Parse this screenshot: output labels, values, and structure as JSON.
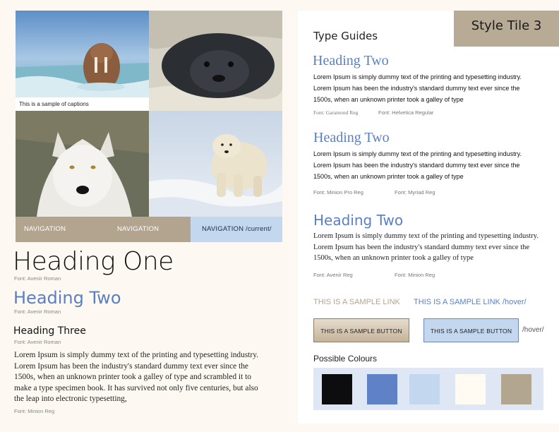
{
  "caption": "This is a sample of captions",
  "nav": {
    "item1": "NAVIGATION",
    "item2": "NAVIGATION",
    "item3": "NAVIGATION /current/"
  },
  "left": {
    "heading_one": "Heading One",
    "heading_one_font": "Font: Avenir Roman",
    "heading_two": "Heading Two",
    "heading_two_font": "Font: Avenir Roman",
    "heading_three": "Heading Three",
    "heading_three_font": "Font: Avenir Roman",
    "body": "Lorem Ipsum is simply dummy text of the printing and typesetting industry. Lorem Ipsum has been the industry's standard dummy text ever since the 1500s, when an unknown printer took a galley of type and scrambled it to make a type specimen book. It has survived not only five centuries, but also the leap into electronic typesetting,",
    "body_font": "Font: Minion Reg"
  },
  "right": {
    "style_tile": "Style Tile 3",
    "type_guides": "Type Guides",
    "guide1": {
      "heading": "Heading Two",
      "body": "Lorem Ipsum is simply dummy text of the printing and typesetting industry. Lorem Ipsum has been the industry's standard dummy text ever since the 1500s, when an unknown printer took a galley of type",
      "font_a": "Font: Garamond Reg",
      "font_b": "Font: Helvetica Regular"
    },
    "guide2": {
      "heading": "Heading Two",
      "body": "Lorem Ipsum is simply dummy text of the printing and typesetting industry. Lorem Ipsum has been the industry's standard dummy text ever since the 1500s, when an unknown printer took a galley of type",
      "font_a": "Font: Minion Pro Reg",
      "font_b": "Font: Myriad Reg"
    },
    "guide3": {
      "heading": "Heading Two",
      "body": "Lorem Ipsum is simply dummy text of the printing and typesetting industry. Lorem Ipsum has been the industry's standard dummy text ever since the 1500s, when an unknown printer took a galley of type",
      "font_a": "Font: Avenir Reg",
      "font_b": "Font: Minion Reg"
    },
    "link": "THIS IS A SAMPLE LINK",
    "link_hover": "THIS IS A SAMPLE LINK /hover/",
    "button": "THIS IS A SAMPLE BUTTON",
    "button_hover": "THIS IS A SAMPLE BUTTON",
    "hover_note": "/hover/",
    "colours_label": "Possible Colours"
  },
  "colours": {
    "brand_blue": "#5a7fc4",
    "taupe": "#b2a48f",
    "light_blue": "#c3d7ef",
    "swatches": [
      "#0d0d0f",
      "#5f82c6",
      "#c3d7ef",
      "#fffbf2",
      "#b3a690"
    ]
  },
  "images": [
    "walrus-photo",
    "seal-photo",
    "arctic-wolf-photo",
    "polar-bear-photo"
  ]
}
